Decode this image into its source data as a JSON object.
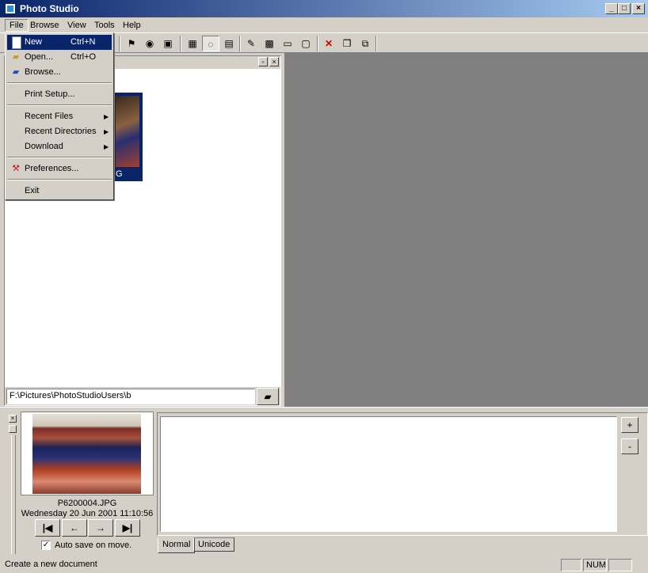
{
  "window": {
    "title": "Photo Studio"
  },
  "menubar": {
    "items": [
      "File",
      "Browse",
      "View",
      "Tools",
      "Help"
    ]
  },
  "file_menu": {
    "new": {
      "label": "New",
      "shortcut": "Ctrl+N"
    },
    "open": {
      "label": "Open...",
      "shortcut": "Ctrl+O"
    },
    "browse": {
      "label": "Browse..."
    },
    "print_setup": {
      "label": "Print Setup..."
    },
    "recent_files": {
      "label": "Recent Files"
    },
    "recent_directories": {
      "label": "Recent Directories"
    },
    "download": {
      "label": "Download"
    },
    "preferences": {
      "label": "Preferences..."
    },
    "exit": {
      "label": "Exit"
    }
  },
  "thumbnail": {
    "caption": "G"
  },
  "path": {
    "value": "F:\\Pictures\\PhotoStudioUsers\\b"
  },
  "preview": {
    "filename": "P6200004.JPG",
    "date": "Wednesday 20 Jun 2001 11:10:56"
  },
  "autosave": {
    "label": "Auto save on move.",
    "checked": true
  },
  "tabs": [
    "Normal",
    "Unicode"
  ],
  "buttons": {
    "plus": "+",
    "minus": "-"
  },
  "status": {
    "text": "Create a new document",
    "num": "NUM"
  },
  "colors": {
    "highlight": "#0a246a",
    "face": "#d4d0c8",
    "viewer_bg": "#808080"
  }
}
